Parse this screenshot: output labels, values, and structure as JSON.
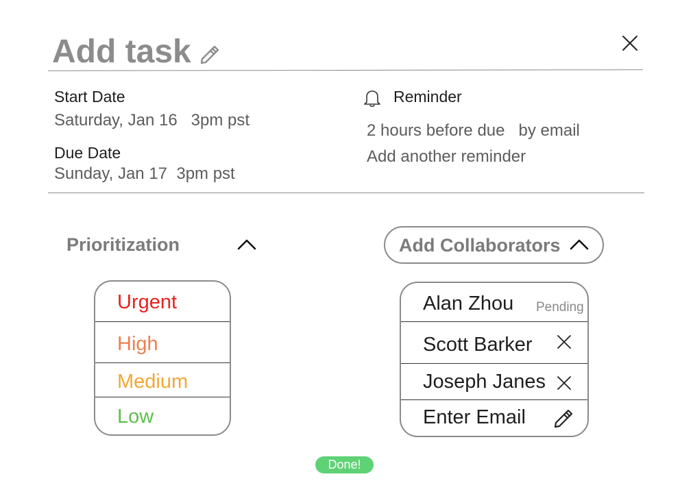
{
  "header": {
    "title": "Add task"
  },
  "dates": {
    "start_label": "Start Date",
    "start_value": "Saturday, Jan 16   3pm pst",
    "due_label": "Due Date",
    "due_value": "Sunday, Jan 17  3pm pst"
  },
  "reminder": {
    "label": "Reminder",
    "value": "2 hours before due   by email",
    "add_label": "Add another reminder"
  },
  "prioritization": {
    "title": "Prioritization",
    "options": [
      {
        "label": "Urgent",
        "color": "#e8221e"
      },
      {
        "label": "High",
        "color": "#ee7f4e"
      },
      {
        "label": "Medium",
        "color": "#f2a832"
      },
      {
        "label": "Low",
        "color": "#5cbf4a"
      }
    ]
  },
  "collaborators": {
    "title": "Add Collaborators",
    "items": [
      {
        "name": "Alan Zhou",
        "status": "Pending"
      },
      {
        "name": "Scott Barker"
      },
      {
        "name": "Joseph Janes"
      }
    ],
    "enter_email": "Enter Email"
  },
  "footer": {
    "done_label": "Done!",
    "done_color": "#5fd276"
  }
}
